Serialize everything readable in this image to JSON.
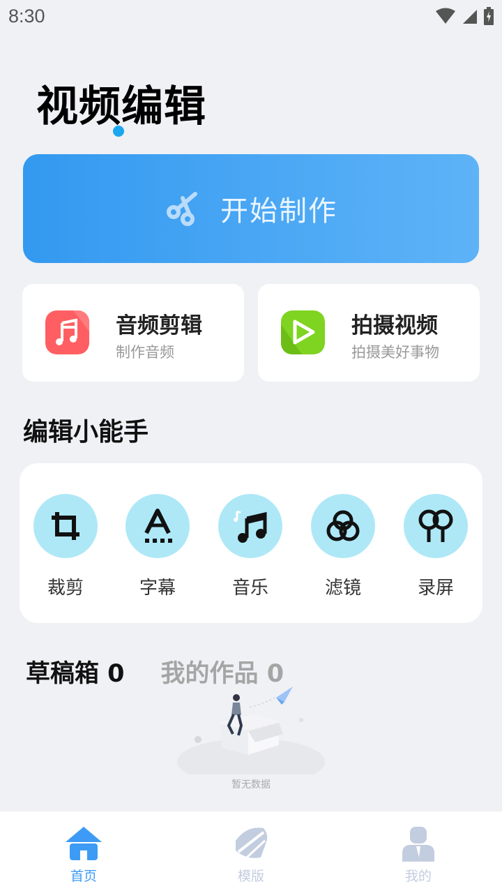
{
  "status": {
    "time": "8:30"
  },
  "header": {
    "title": "视频编辑"
  },
  "start": {
    "label": "开始制作",
    "icon": "scissors-icon"
  },
  "features": [
    {
      "title": "音频剪辑",
      "subtitle": "制作音频",
      "icon": "music-note-icon",
      "color": "#ff5f62"
    },
    {
      "title": "拍摄视频",
      "subtitle": "拍摄美好事物",
      "icon": "play-icon",
      "color": "#7fd321"
    }
  ],
  "tools_section": {
    "title": "编辑小能手",
    "items": [
      {
        "label": "裁剪",
        "icon": "crop-icon"
      },
      {
        "label": "字幕",
        "icon": "subtitle-icon"
      },
      {
        "label": "音乐",
        "icon": "music-icon"
      },
      {
        "label": "滤镜",
        "icon": "filter-icon"
      },
      {
        "label": "录屏",
        "icon": "record-screen-icon"
      }
    ]
  },
  "works_tabs": [
    {
      "label": "草稿箱 0",
      "active": true
    },
    {
      "label": "我的作品 0",
      "active": false
    }
  ],
  "empty": {
    "text": "暂无数据"
  },
  "nav": [
    {
      "label": "首页",
      "icon": "home-icon",
      "active": true
    },
    {
      "label": "模版",
      "icon": "template-icon",
      "active": false
    },
    {
      "label": "我的",
      "icon": "profile-icon",
      "active": false
    }
  ],
  "colors": {
    "accent": "#3399f0",
    "tool_bg": "#aee8f7",
    "nav_active": "#3d9bf5",
    "nav_inactive": "#c3cde0"
  }
}
